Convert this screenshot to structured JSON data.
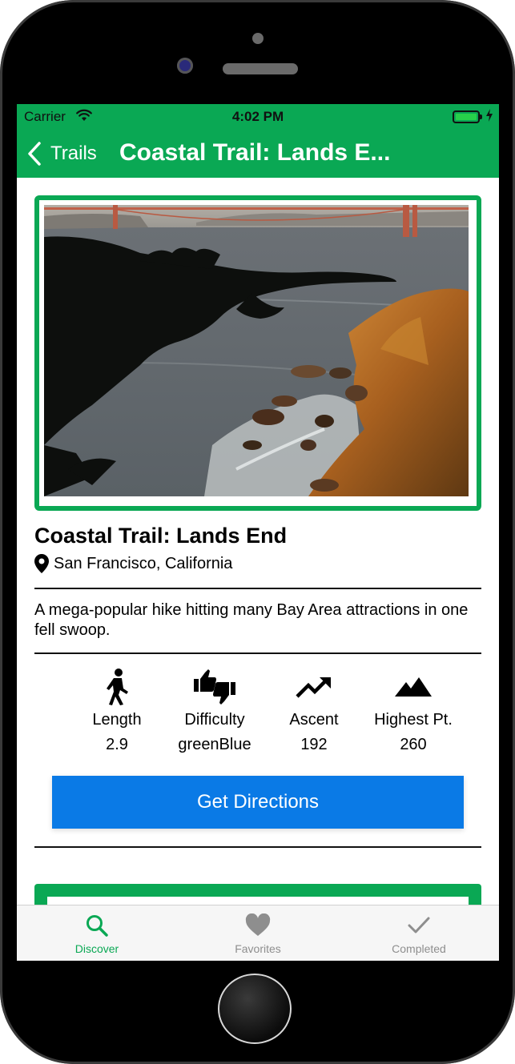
{
  "status_bar": {
    "carrier": "Carrier",
    "time": "4:02 PM",
    "battery_color": "#27d04a"
  },
  "nav": {
    "back_label": "Trails",
    "title": "Coastal Trail: Lands E..."
  },
  "trail": {
    "name": "Coastal Trail: Lands End",
    "location": "San Francisco, California",
    "description": "A mega-popular hike hitting many Bay Area attractions in one fell swoop."
  },
  "stats": [
    {
      "icon": "hiker-icon",
      "label": "Length",
      "value": "2.9"
    },
    {
      "icon": "thumbs-up-down-icon",
      "label": "Difficulty",
      "value": "greenBlue"
    },
    {
      "icon": "trending-up-icon",
      "label": "Ascent",
      "value": "192"
    },
    {
      "icon": "mountains-icon",
      "label": "Highest Pt.",
      "value": "260"
    }
  ],
  "directions_button": {
    "label": "Get Directions",
    "color": "#0a7ae6"
  },
  "tabs": [
    {
      "icon": "search-icon",
      "label": "Discover",
      "active": true
    },
    {
      "icon": "heart-icon",
      "label": "Favorites",
      "active": false
    },
    {
      "icon": "checkmark-icon",
      "label": "Completed",
      "active": false
    }
  ],
  "colors": {
    "brand_green": "#0aa854",
    "tab_inactive": "#8e8e8e"
  }
}
